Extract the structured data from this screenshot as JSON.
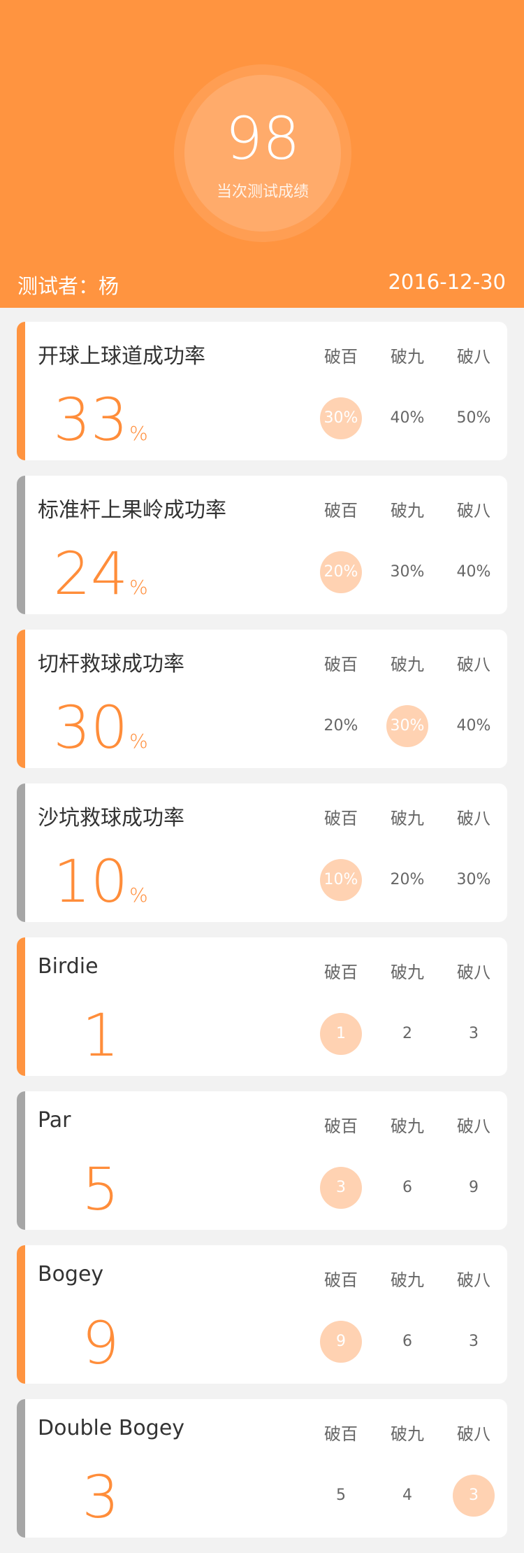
{
  "header": {
    "score": "98",
    "score_label": "当次测试成绩",
    "tester": "测试者：杨",
    "date": "2016-12-30"
  },
  "colors": {
    "accent": "#ff9440",
    "value_orange": "#ff8d3a",
    "highlight_circle": "#ffd2b2",
    "bar_gray": "#a6a6a6"
  },
  "cards": [
    {
      "title": "开球上球道成功率",
      "value": "33",
      "unit": "%",
      "bar": "orange",
      "labels": [
        "破百",
        "破九",
        "破八"
      ],
      "values": [
        "30%",
        "40%",
        "50%"
      ],
      "highlight": 0
    },
    {
      "title": "标准杆上果岭成功率",
      "value": "24",
      "unit": "%",
      "bar": "gray",
      "labels": [
        "破百",
        "破九",
        "破八"
      ],
      "values": [
        "20%",
        "30%",
        "40%"
      ],
      "highlight": 0
    },
    {
      "title": "切杆救球成功率",
      "value": "30",
      "unit": "%",
      "bar": "orange",
      "labels": [
        "破百",
        "破九",
        "破八"
      ],
      "values": [
        "20%",
        "30%",
        "40%"
      ],
      "highlight": 1
    },
    {
      "title": "沙坑救球成功率",
      "value": "10",
      "unit": "%",
      "bar": "gray",
      "labels": [
        "破百",
        "破九",
        "破八"
      ],
      "values": [
        "10%",
        "20%",
        "30%"
      ],
      "highlight": 0
    },
    {
      "title": "Birdie",
      "value": "1",
      "unit": "",
      "bar": "orange",
      "labels": [
        "破百",
        "破九",
        "破八"
      ],
      "values": [
        "1",
        "2",
        "3"
      ],
      "highlight": 0
    },
    {
      "title": "Par",
      "value": "5",
      "unit": "",
      "bar": "gray",
      "labels": [
        "破百",
        "破九",
        "破八"
      ],
      "values": [
        "3",
        "6",
        "9"
      ],
      "highlight": 0
    },
    {
      "title": "Bogey",
      "value": "9",
      "unit": "",
      "bar": "orange",
      "labels": [
        "破百",
        "破九",
        "破八"
      ],
      "values": [
        "9",
        "6",
        "3"
      ],
      "highlight": 0
    },
    {
      "title": "Double Bogey",
      "value": "3",
      "unit": "",
      "bar": "gray",
      "labels": [
        "破百",
        "破九",
        "破八"
      ],
      "values": [
        "5",
        "4",
        "3"
      ],
      "highlight": 2
    }
  ]
}
